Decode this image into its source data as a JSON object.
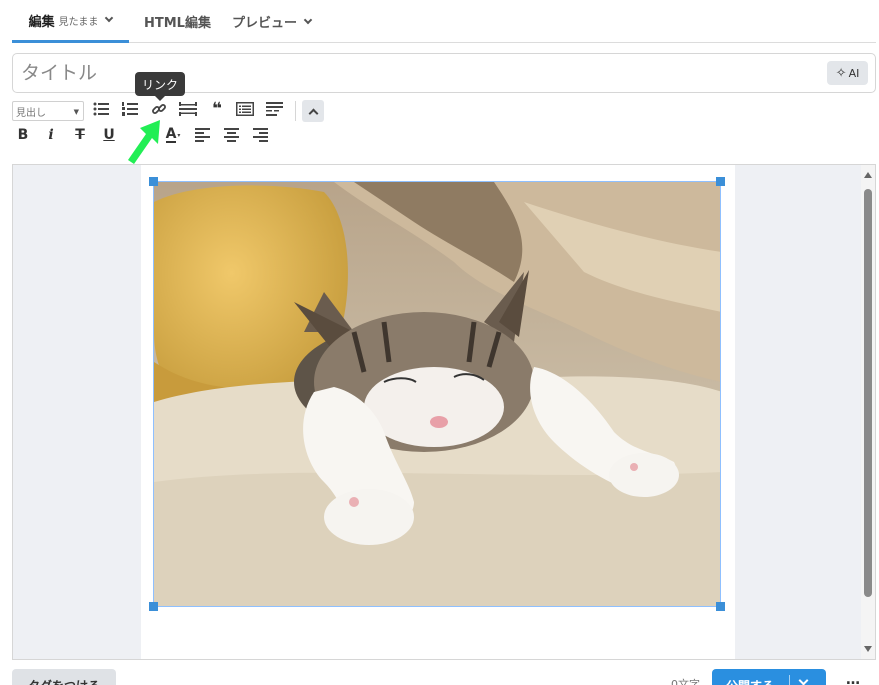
{
  "tabs": {
    "edit_label": "編集",
    "edit_mode": "見たまま",
    "html_label": "HTML編集",
    "preview_label": "プレビュー"
  },
  "title": {
    "placeholder": "タイトル",
    "value": "",
    "ai_label": "AI"
  },
  "toolbar": {
    "heading_select": "見出し",
    "bold": "B",
    "italic": "i",
    "strike": "T",
    "underline": "U",
    "text_color": "A",
    "tooltip": "リンク"
  },
  "editor": {
    "image": {
      "description_icon": "cat-photo"
    }
  },
  "footer": {
    "tag_button": "タグをつける",
    "char_count": "0文字",
    "publish_button": "公開する",
    "more": "…"
  },
  "colors": {
    "accent": "#2a8fe0",
    "annotation_arrow": "#22ee55",
    "selection": "#3b8fd8"
  }
}
